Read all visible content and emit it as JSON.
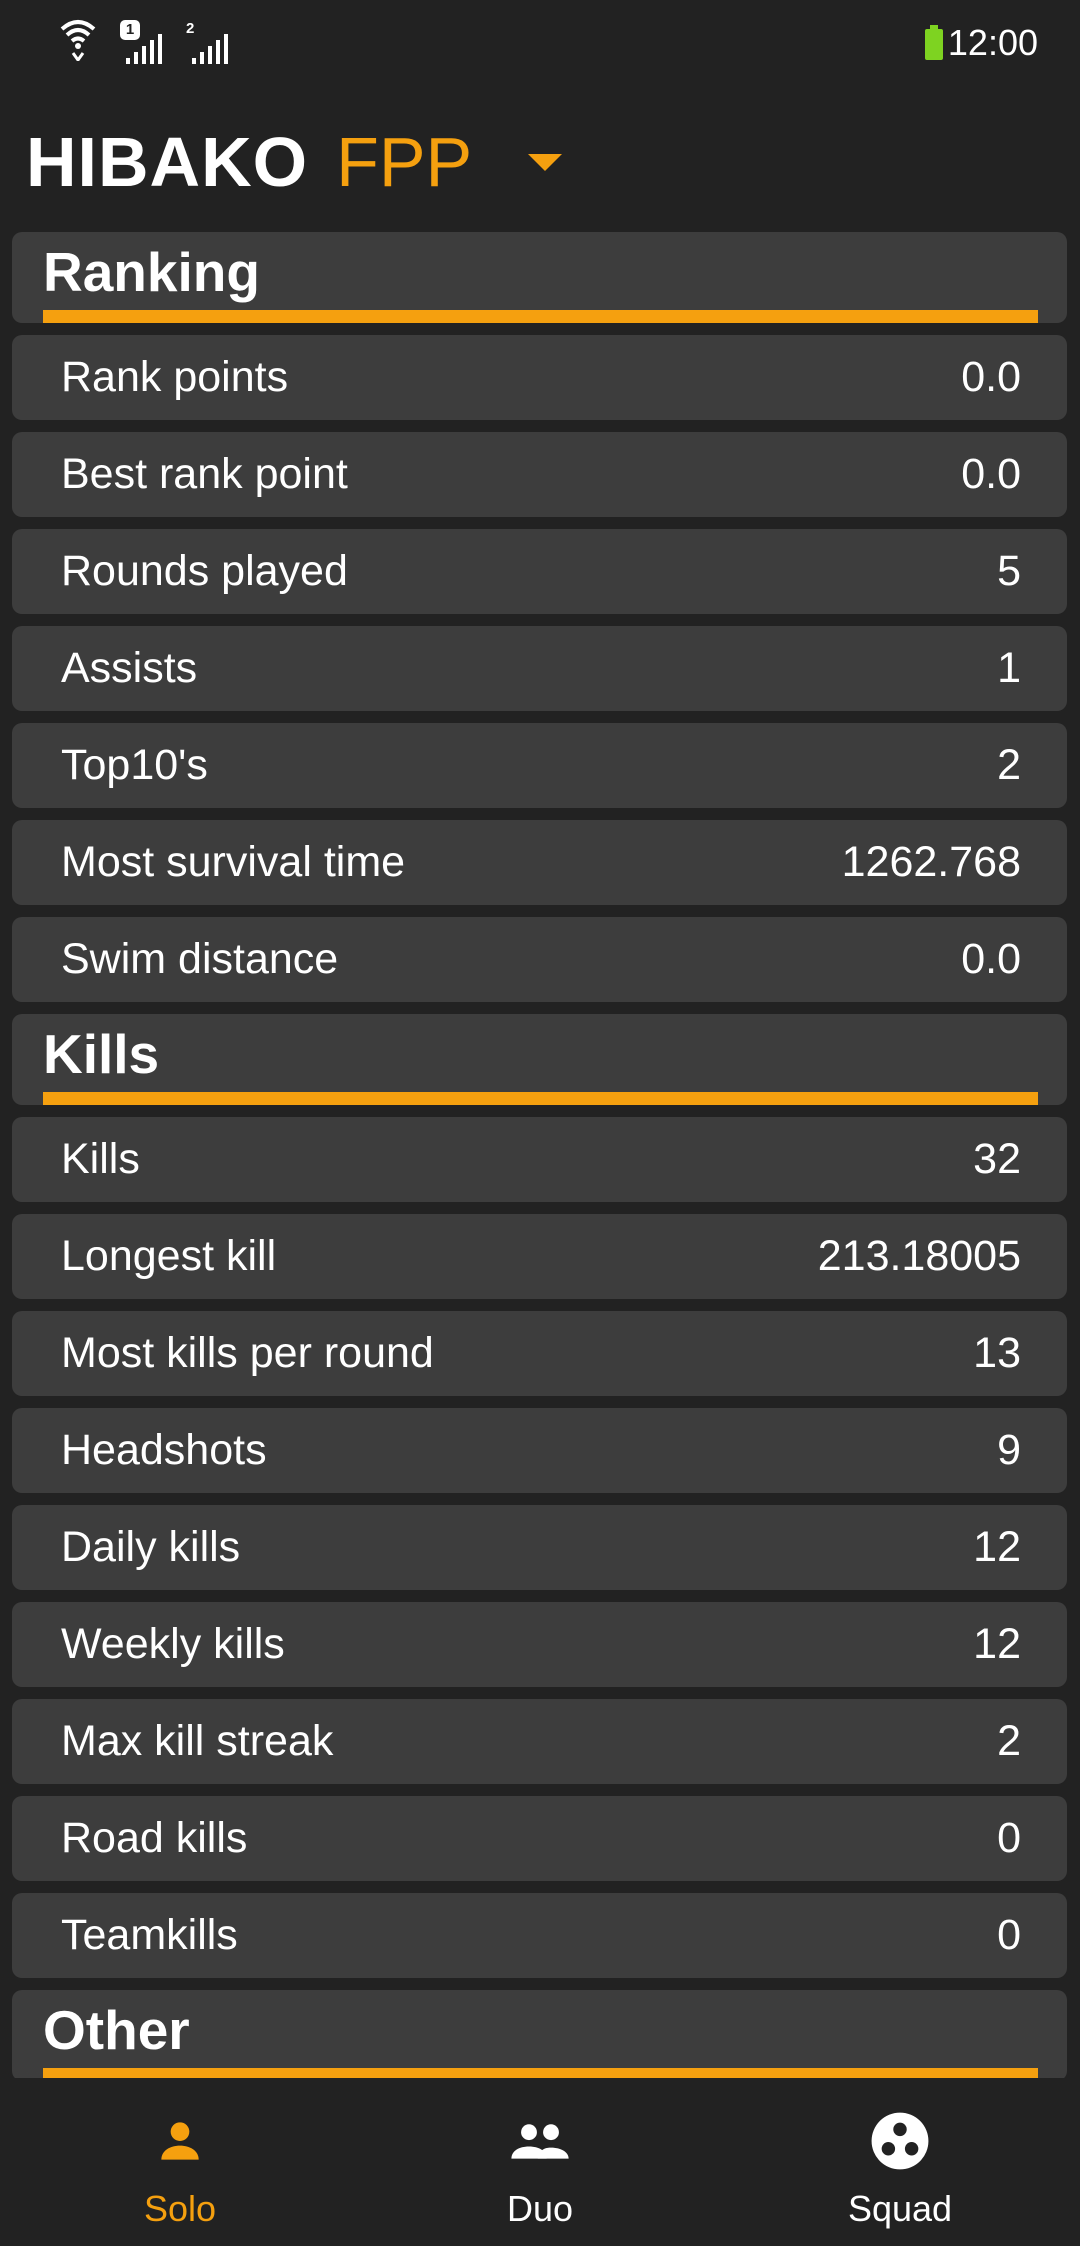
{
  "status_bar": {
    "time": "12:00",
    "sim1_label": "1",
    "sim2_label": "2",
    "colors": {
      "battery": "#7ed321"
    }
  },
  "header": {
    "player_name": "HIBAKO",
    "mode": "FPP"
  },
  "sections": [
    {
      "title": "Ranking",
      "rows": [
        {
          "label": "Rank points",
          "value": "0.0"
        },
        {
          "label": "Best rank point",
          "value": "0.0"
        },
        {
          "label": "Rounds played",
          "value": "5"
        },
        {
          "label": "Assists",
          "value": "1"
        },
        {
          "label": "Top10's",
          "value": "2"
        },
        {
          "label": "Most survival time",
          "value": "1262.768"
        },
        {
          "label": "Swim distance",
          "value": "0.0"
        }
      ]
    },
    {
      "title": "Kills",
      "rows": [
        {
          "label": "Kills",
          "value": "32"
        },
        {
          "label": "Longest kill",
          "value": "213.18005"
        },
        {
          "label": "Most kills per round",
          "value": "13"
        },
        {
          "label": "Headshots",
          "value": "9"
        },
        {
          "label": "Daily kills",
          "value": "12"
        },
        {
          "label": "Weekly kills",
          "value": "12"
        },
        {
          "label": "Max kill streak",
          "value": "2"
        },
        {
          "label": "Road kills",
          "value": "0"
        },
        {
          "label": "Teamkills",
          "value": "0"
        }
      ]
    },
    {
      "title": "Other",
      "rows": []
    }
  ],
  "bottom_nav": {
    "items": [
      {
        "label": "Solo",
        "icon": "person-icon",
        "active": true
      },
      {
        "label": "Duo",
        "icon": "people-icon",
        "active": false
      },
      {
        "label": "Squad",
        "icon": "group-circle-icon",
        "active": false
      }
    ]
  },
  "colors": {
    "accent": "#f5a00f",
    "background": "#222222",
    "card": "#3d3d3d",
    "text": "#ffffff"
  }
}
